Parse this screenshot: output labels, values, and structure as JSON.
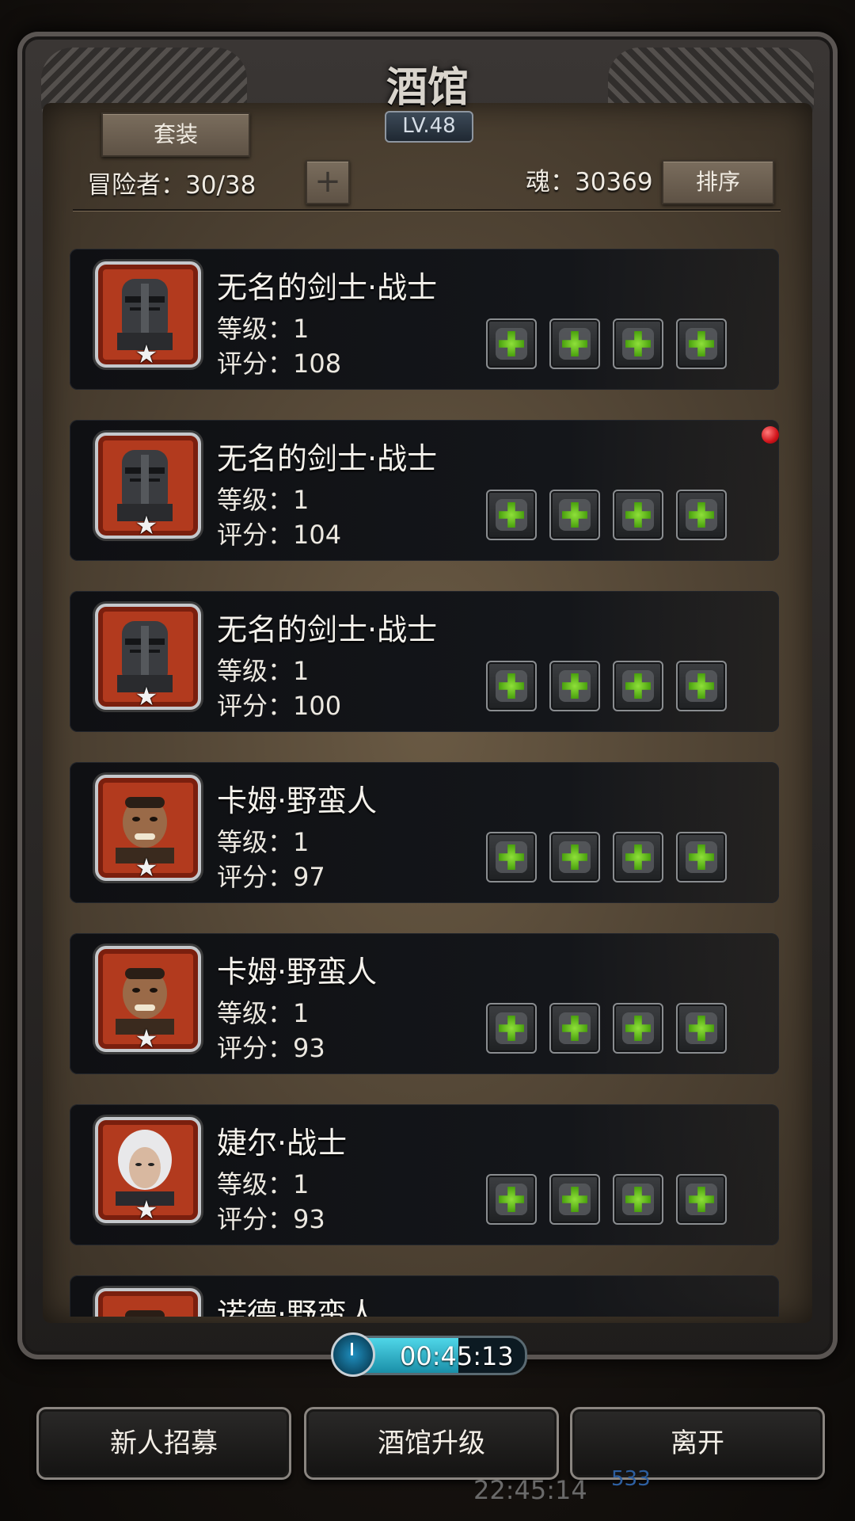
{
  "header": {
    "title": "酒馆",
    "level": "LV.48",
    "outfit_button": "套装",
    "adventurers": "冒险者：30/38",
    "add_symbol": "+",
    "souls": "魂：30369",
    "sort_button": "排序"
  },
  "heroes": [
    {
      "name": "无名的剑士·战士",
      "level": "等级：1",
      "score": "评分：108",
      "portrait": "knight-helmet"
    },
    {
      "name": "无名的剑士·战士",
      "level": "等级：1",
      "score": "评分：104",
      "portrait": "knight-helmet"
    },
    {
      "name": "无名的剑士·战士",
      "level": "等级：1",
      "score": "评分：100",
      "portrait": "knight-helmet"
    },
    {
      "name": "卡姆·野蛮人",
      "level": "等级：1",
      "score": "评分：97",
      "portrait": "barbarian-face"
    },
    {
      "name": "卡姆·野蛮人",
      "level": "等级：1",
      "score": "评分：93",
      "portrait": "barbarian-face"
    },
    {
      "name": "婕尔·战士",
      "level": "等级：1",
      "score": "评分：93",
      "portrait": "white-haired-warrior"
    },
    {
      "name": "诺德·野蛮人",
      "level": "",
      "score": "",
      "portrait": "barbarian-face"
    }
  ],
  "equipment_slots": [
    "weapon-slot-icon",
    "armor-slot-icon",
    "accessory-slot-icon",
    "accessory-slot-icon"
  ],
  "timer": {
    "text": "00:45:13",
    "progress": 0.65
  },
  "buttons": {
    "recruit": "新人招募",
    "upgrade": "酒馆升级",
    "leave": "离开"
  },
  "background": {
    "clock": "22:45:14",
    "count": "533"
  },
  "colors": {
    "plus_green": "#5cc21a",
    "portrait_red": "#b23a1e",
    "notification_red": "#d0131a"
  }
}
